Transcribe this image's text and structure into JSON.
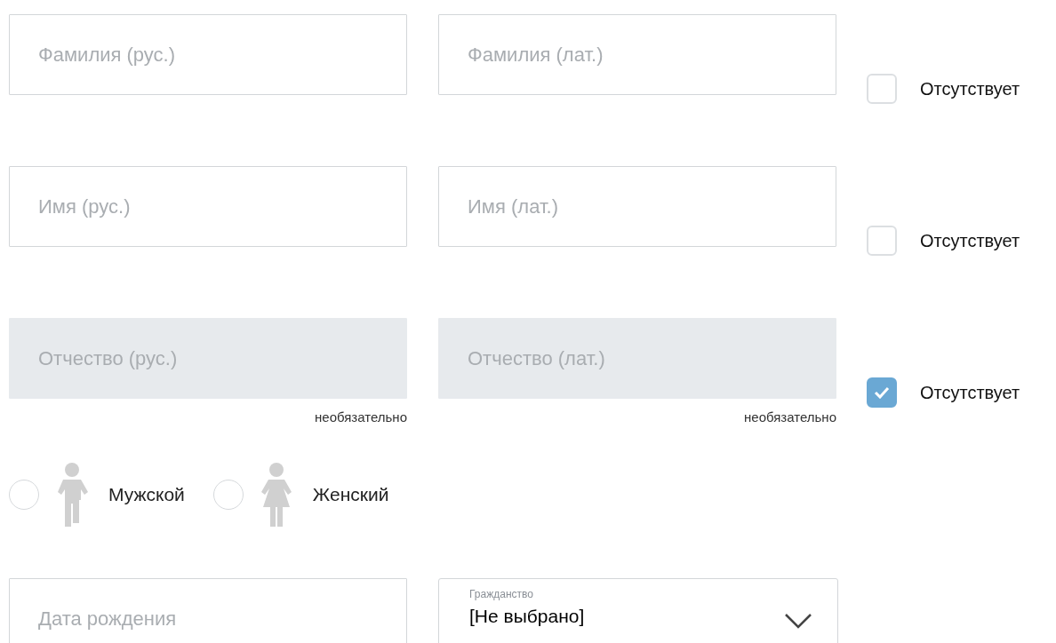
{
  "name_rows": [
    {
      "fields": [
        {
          "placeholder": "Фамилия (рус.)",
          "disabled": false
        },
        {
          "placeholder": "Фамилия (лат.)",
          "disabled": false
        }
      ],
      "absent": {
        "label": "Отсутствует",
        "checked": false
      }
    },
    {
      "fields": [
        {
          "placeholder": "Имя (рус.)",
          "disabled": false
        },
        {
          "placeholder": "Имя (лат.)",
          "disabled": false
        }
      ],
      "absent": {
        "label": "Отсутствует",
        "checked": false
      }
    },
    {
      "fields": [
        {
          "placeholder": "Отчество (рус.)",
          "disabled": true,
          "hint": "необязательно"
        },
        {
          "placeholder": "Отчество (лат.)",
          "disabled": true,
          "hint": "необязательно"
        }
      ],
      "absent": {
        "label": "Отсутствует",
        "checked": true
      }
    }
  ],
  "gender": [
    {
      "kind": "male",
      "label": "Мужской",
      "selected": false
    },
    {
      "kind": "female",
      "label": "Женский",
      "selected": false
    }
  ],
  "birth_date": {
    "placeholder": "Дата рождения"
  },
  "citizenship": {
    "label": "Гражданство",
    "value": "[Не выбрано]"
  }
}
